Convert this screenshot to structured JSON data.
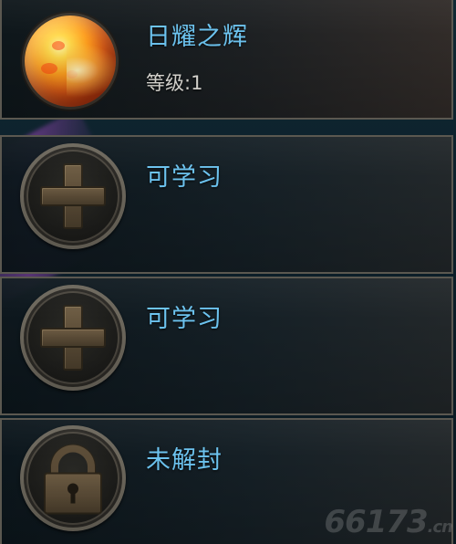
{
  "skills": [
    {
      "icon": "sun-orb-icon",
      "name": "日耀之辉",
      "level_label": "等级",
      "level_sep": ":",
      "level_value": "1",
      "state": "learned"
    },
    {
      "icon": "plus-icon",
      "name": "可学习",
      "state": "learnable"
    },
    {
      "icon": "plus-icon",
      "name": "可学习",
      "state": "learnable"
    },
    {
      "icon": "lock-icon",
      "name": "未解封",
      "state": "locked"
    }
  ],
  "watermark": {
    "main": "66173",
    "suffix": ".cn"
  },
  "colors": {
    "title_blue": "#6cc3ef",
    "panel_border": "#5b5850",
    "icon_bronze": "#5b4c37"
  }
}
